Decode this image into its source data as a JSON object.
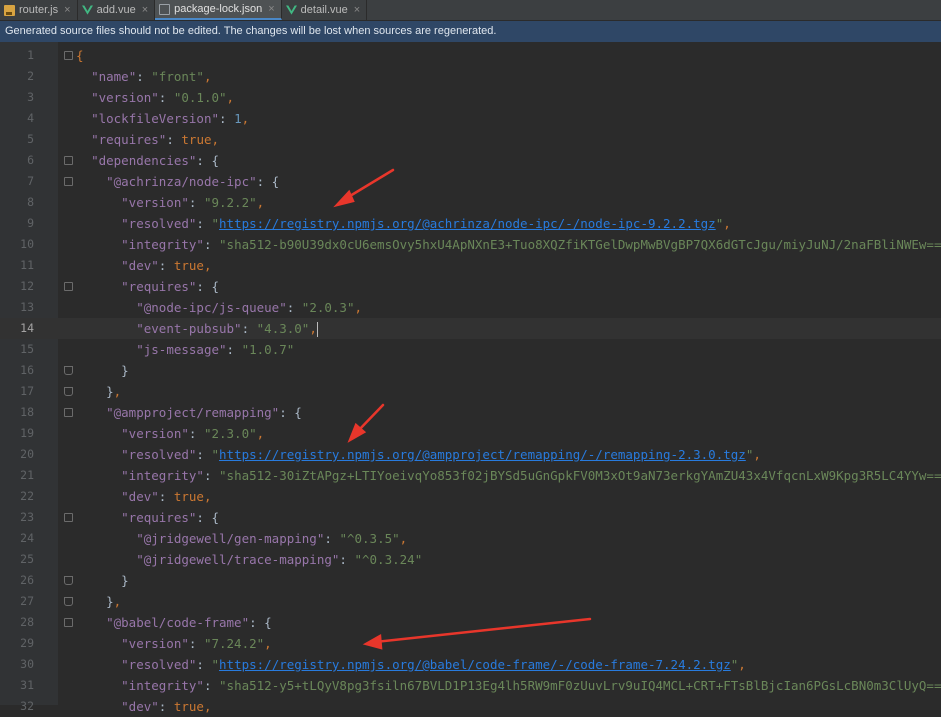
{
  "tabs": [
    {
      "label": "router.js",
      "icon": "js-file-icon",
      "active": false
    },
    {
      "label": "add.vue",
      "icon": "vue-file-icon",
      "active": false
    },
    {
      "label": "package-lock.json",
      "icon": "json-file-icon",
      "active": true
    },
    {
      "label": "detail.vue",
      "icon": "vue-file-icon",
      "active": false
    }
  ],
  "close_glyph": "×",
  "notice": "Generated source files should not be edited. The changes will be lost when sources are regenerated.",
  "current_line": 14,
  "lines": [
    {
      "n": "1",
      "tokens": [
        [
          "p",
          "{"
        ]
      ]
    },
    {
      "n": "2",
      "tokens": [
        [
          "",
          "  "
        ],
        [
          "k",
          "\"name\""
        ],
        [
          "",
          ": "
        ],
        [
          "s",
          "\"front\""
        ],
        [
          "p",
          ","
        ]
      ]
    },
    {
      "n": "3",
      "tokens": [
        [
          "",
          "  "
        ],
        [
          "k",
          "\"version\""
        ],
        [
          "",
          ": "
        ],
        [
          "s",
          "\"0.1.0\""
        ],
        [
          "p",
          ","
        ]
      ]
    },
    {
      "n": "4",
      "tokens": [
        [
          "",
          "  "
        ],
        [
          "k",
          "\"lockfileVersion\""
        ],
        [
          "",
          ": "
        ],
        [
          "n",
          "1"
        ],
        [
          "p",
          ","
        ]
      ]
    },
    {
      "n": "5",
      "tokens": [
        [
          "",
          "  "
        ],
        [
          "k",
          "\"requires\""
        ],
        [
          "",
          ": "
        ],
        [
          "kw",
          "true"
        ],
        [
          "p",
          ","
        ]
      ]
    },
    {
      "n": "6",
      "tokens": [
        [
          "",
          "  "
        ],
        [
          "k",
          "\"dependencies\""
        ],
        [
          "",
          ": {"
        ]
      ]
    },
    {
      "n": "7",
      "tokens": [
        [
          "",
          "    "
        ],
        [
          "k",
          "\"@achrinza/node-ipc\""
        ],
        [
          "",
          ": {"
        ]
      ]
    },
    {
      "n": "8",
      "tokens": [
        [
          "",
          "      "
        ],
        [
          "k",
          "\"version\""
        ],
        [
          "",
          ": "
        ],
        [
          "s",
          "\"9.2.2\""
        ],
        [
          "p",
          ","
        ]
      ]
    },
    {
      "n": "9",
      "tokens": [
        [
          "",
          "      "
        ],
        [
          "k",
          "\"resolved\""
        ],
        [
          "",
          ": "
        ],
        [
          "s",
          "\""
        ],
        [
          "u",
          "https://registry.npmjs.org/@achrinza/node-ipc/-/node-ipc-9.2.2.tgz"
        ],
        [
          "s",
          "\""
        ],
        [
          "p",
          ","
        ]
      ]
    },
    {
      "n": "10",
      "tokens": [
        [
          "",
          "      "
        ],
        [
          "k",
          "\"integrity\""
        ],
        [
          "",
          ": "
        ],
        [
          "s",
          "\"sha512-b90U39dx0cU6emsOvy5hxU4ApNXnE3+Tuo8XQZfiKTGelDwpMwBVgBP7QX6dGTcJgu/miyJuNJ/2naFBliNWEw==\""
        ],
        [
          "p",
          ","
        ]
      ]
    },
    {
      "n": "11",
      "tokens": [
        [
          "",
          "      "
        ],
        [
          "k",
          "\"dev\""
        ],
        [
          "",
          ": "
        ],
        [
          "kw",
          "true"
        ],
        [
          "p",
          ","
        ]
      ]
    },
    {
      "n": "12",
      "tokens": [
        [
          "",
          "      "
        ],
        [
          "k",
          "\"requires\""
        ],
        [
          "",
          ": {"
        ]
      ]
    },
    {
      "n": "13",
      "tokens": [
        [
          "",
          "        "
        ],
        [
          "k",
          "\"@node-ipc/js-queue\""
        ],
        [
          "",
          ": "
        ],
        [
          "s",
          "\"2.0.3\""
        ],
        [
          "p",
          ","
        ]
      ]
    },
    {
      "n": "14",
      "tokens": [
        [
          "",
          "        "
        ],
        [
          "k",
          "\"event-pubsub\""
        ],
        [
          "",
          ": "
        ],
        [
          "s",
          "\"4.3.0\""
        ],
        [
          "p",
          ","
        ]
      ],
      "caret": true
    },
    {
      "n": "15",
      "tokens": [
        [
          "",
          "        "
        ],
        [
          "k",
          "\"js-message\""
        ],
        [
          "",
          ": "
        ],
        [
          "s",
          "\"1.0.7\""
        ]
      ]
    },
    {
      "n": "16",
      "tokens": [
        [
          "",
          "      }"
        ]
      ]
    },
    {
      "n": "17",
      "tokens": [
        [
          "",
          "    }"
        ],
        [
          "p",
          ","
        ]
      ]
    },
    {
      "n": "18",
      "tokens": [
        [
          "",
          "    "
        ],
        [
          "k",
          "\"@ampproject/remapping\""
        ],
        [
          "",
          ": {"
        ]
      ]
    },
    {
      "n": "19",
      "tokens": [
        [
          "",
          "      "
        ],
        [
          "k",
          "\"version\""
        ],
        [
          "",
          ": "
        ],
        [
          "s",
          "\"2.3.0\""
        ],
        [
          "p",
          ","
        ]
      ]
    },
    {
      "n": "20",
      "tokens": [
        [
          "",
          "      "
        ],
        [
          "k",
          "\"resolved\""
        ],
        [
          "",
          ": "
        ],
        [
          "s",
          "\""
        ],
        [
          "u",
          "https://registry.npmjs.org/@ampproject/remapping/-/remapping-2.3.0.tgz"
        ],
        [
          "s",
          "\""
        ],
        [
          "p",
          ","
        ]
      ]
    },
    {
      "n": "21",
      "tokens": [
        [
          "",
          "      "
        ],
        [
          "k",
          "\"integrity\""
        ],
        [
          "",
          ": "
        ],
        [
          "s",
          "\"sha512-30iZtAPgz+LTIYoeivqYo853f02jBYSd5uGnGpkFV0M3xOt9aN73erkgYAmZU43x4VfqcnLxW9Kpg3R5LC4YYw==\""
        ],
        [
          "p",
          ","
        ]
      ]
    },
    {
      "n": "22",
      "tokens": [
        [
          "",
          "      "
        ],
        [
          "k",
          "\"dev\""
        ],
        [
          "",
          ": "
        ],
        [
          "kw",
          "true"
        ],
        [
          "p",
          ","
        ]
      ]
    },
    {
      "n": "23",
      "tokens": [
        [
          "",
          "      "
        ],
        [
          "k",
          "\"requires\""
        ],
        [
          "",
          ": {"
        ]
      ]
    },
    {
      "n": "24",
      "tokens": [
        [
          "",
          "        "
        ],
        [
          "k",
          "\"@jridgewell/gen-mapping\""
        ],
        [
          "",
          ": "
        ],
        [
          "s",
          "\"^0.3.5\""
        ],
        [
          "p",
          ","
        ]
      ]
    },
    {
      "n": "25",
      "tokens": [
        [
          "",
          "        "
        ],
        [
          "k",
          "\"@jridgewell/trace-mapping\""
        ],
        [
          "",
          ": "
        ],
        [
          "s",
          "\"^0.3.24\""
        ]
      ]
    },
    {
      "n": "26",
      "tokens": [
        [
          "",
          "      }"
        ]
      ]
    },
    {
      "n": "27",
      "tokens": [
        [
          "",
          "    }"
        ],
        [
          "p",
          ","
        ]
      ]
    },
    {
      "n": "28",
      "tokens": [
        [
          "",
          "    "
        ],
        [
          "k",
          "\"@babel/code-frame\""
        ],
        [
          "",
          ": {"
        ]
      ]
    },
    {
      "n": "29",
      "tokens": [
        [
          "",
          "      "
        ],
        [
          "k",
          "\"version\""
        ],
        [
          "",
          ": "
        ],
        [
          "s",
          "\"7.24.2\""
        ],
        [
          "p",
          ","
        ]
      ]
    },
    {
      "n": "30",
      "tokens": [
        [
          "",
          "      "
        ],
        [
          "k",
          "\"resolved\""
        ],
        [
          "",
          ": "
        ],
        [
          "s",
          "\""
        ],
        [
          "u",
          "https://registry.npmjs.org/@babel/code-frame/-/code-frame-7.24.2.tgz"
        ],
        [
          "s",
          "\""
        ],
        [
          "p",
          ","
        ]
      ]
    },
    {
      "n": "31",
      "tokens": [
        [
          "",
          "      "
        ],
        [
          "k",
          "\"integrity\""
        ],
        [
          "",
          ": "
        ],
        [
          "s",
          "\"sha512-y5+tLQyV8pg3fsiln67BVLD1P13Eg4lh5RW9mF0zUuvLrv9uIQ4MCL+CRT+FTsBlBjcIan6PGsLcBN0m3ClUyQ==\""
        ],
        [
          "p",
          ","
        ]
      ]
    },
    {
      "n": "32",
      "tokens": [
        [
          "",
          "      "
        ],
        [
          "k",
          "\"dev\""
        ],
        [
          "",
          ": "
        ],
        [
          "kw",
          "true"
        ],
        [
          "p",
          ","
        ]
      ]
    }
  ],
  "fold_markers": [
    {
      "line": 1,
      "kind": "open"
    },
    {
      "line": 6,
      "kind": "open"
    },
    {
      "line": 7,
      "kind": "open"
    },
    {
      "line": 12,
      "kind": "open"
    },
    {
      "line": 16,
      "kind": "end"
    },
    {
      "line": 17,
      "kind": "end"
    },
    {
      "line": 18,
      "kind": "open"
    },
    {
      "line": 23,
      "kind": "open"
    },
    {
      "line": 26,
      "kind": "end"
    },
    {
      "line": 27,
      "kind": "end"
    },
    {
      "line": 28,
      "kind": "open"
    }
  ],
  "annotation_color": "#e8362b"
}
